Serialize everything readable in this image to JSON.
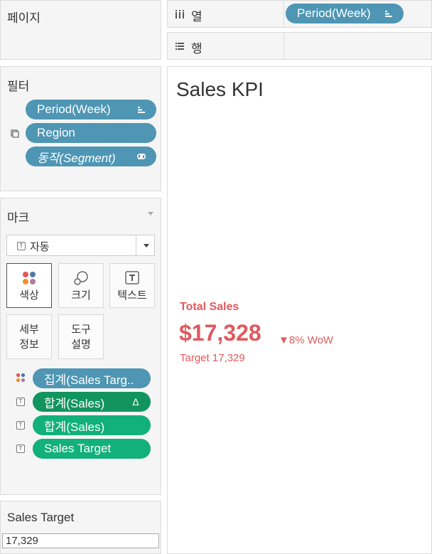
{
  "pages_card": {
    "title": "페이지"
  },
  "columns_shelf": {
    "label": "열",
    "icon": "columns-icon",
    "pills": [
      {
        "label": "Period(Week)",
        "icon": "sort-icon"
      }
    ]
  },
  "rows_shelf": {
    "label": "행",
    "icon": "rows-icon"
  },
  "filters_card": {
    "title": "필터",
    "pills": [
      {
        "label": "Period(Week)",
        "icon": "sort-icon",
        "style": "normal"
      },
      {
        "label": "Region",
        "icon": "",
        "left_icon": "context-filter-icon",
        "style": "normal"
      },
      {
        "label": "동작(Segment)",
        "icon": "link-icon",
        "style": "italic"
      }
    ]
  },
  "marks_card": {
    "title": "마크",
    "mark_type": "자동",
    "buttons": [
      {
        "label": "색상",
        "icon": "color-icon"
      },
      {
        "label": "크기",
        "icon": "size-icon"
      },
      {
        "label": "텍스트",
        "icon": "text-icon"
      },
      {
        "label_line1": "세부",
        "label_line2": "정보"
      },
      {
        "label_line1": "도구",
        "label_line2": "설명"
      }
    ],
    "fields": [
      {
        "label": "집계(Sales Targ..",
        "mark_icon": "color-dots-icon",
        "end_icon": "",
        "color": "#4e96b4"
      },
      {
        "label": "합계(Sales)",
        "mark_icon": "text-mark-icon",
        "end_icon": "Δ",
        "color": "#12945e"
      },
      {
        "label": "합계(Sales)",
        "mark_icon": "text-mark-icon",
        "end_icon": "",
        "color": "#12b07a"
      },
      {
        "label": "Sales Target",
        "mark_icon": "text-mark-icon",
        "end_icon": "",
        "color": "#12b07a"
      }
    ]
  },
  "parameter_card": {
    "title": "Sales Target",
    "value": "17,329"
  },
  "view": {
    "title": "Sales KPI",
    "kpi": {
      "label": "Total Sales",
      "value": "$17,328",
      "change": "▼8% WoW",
      "target": "Target 17,329",
      "color": "#e05a5f"
    }
  }
}
